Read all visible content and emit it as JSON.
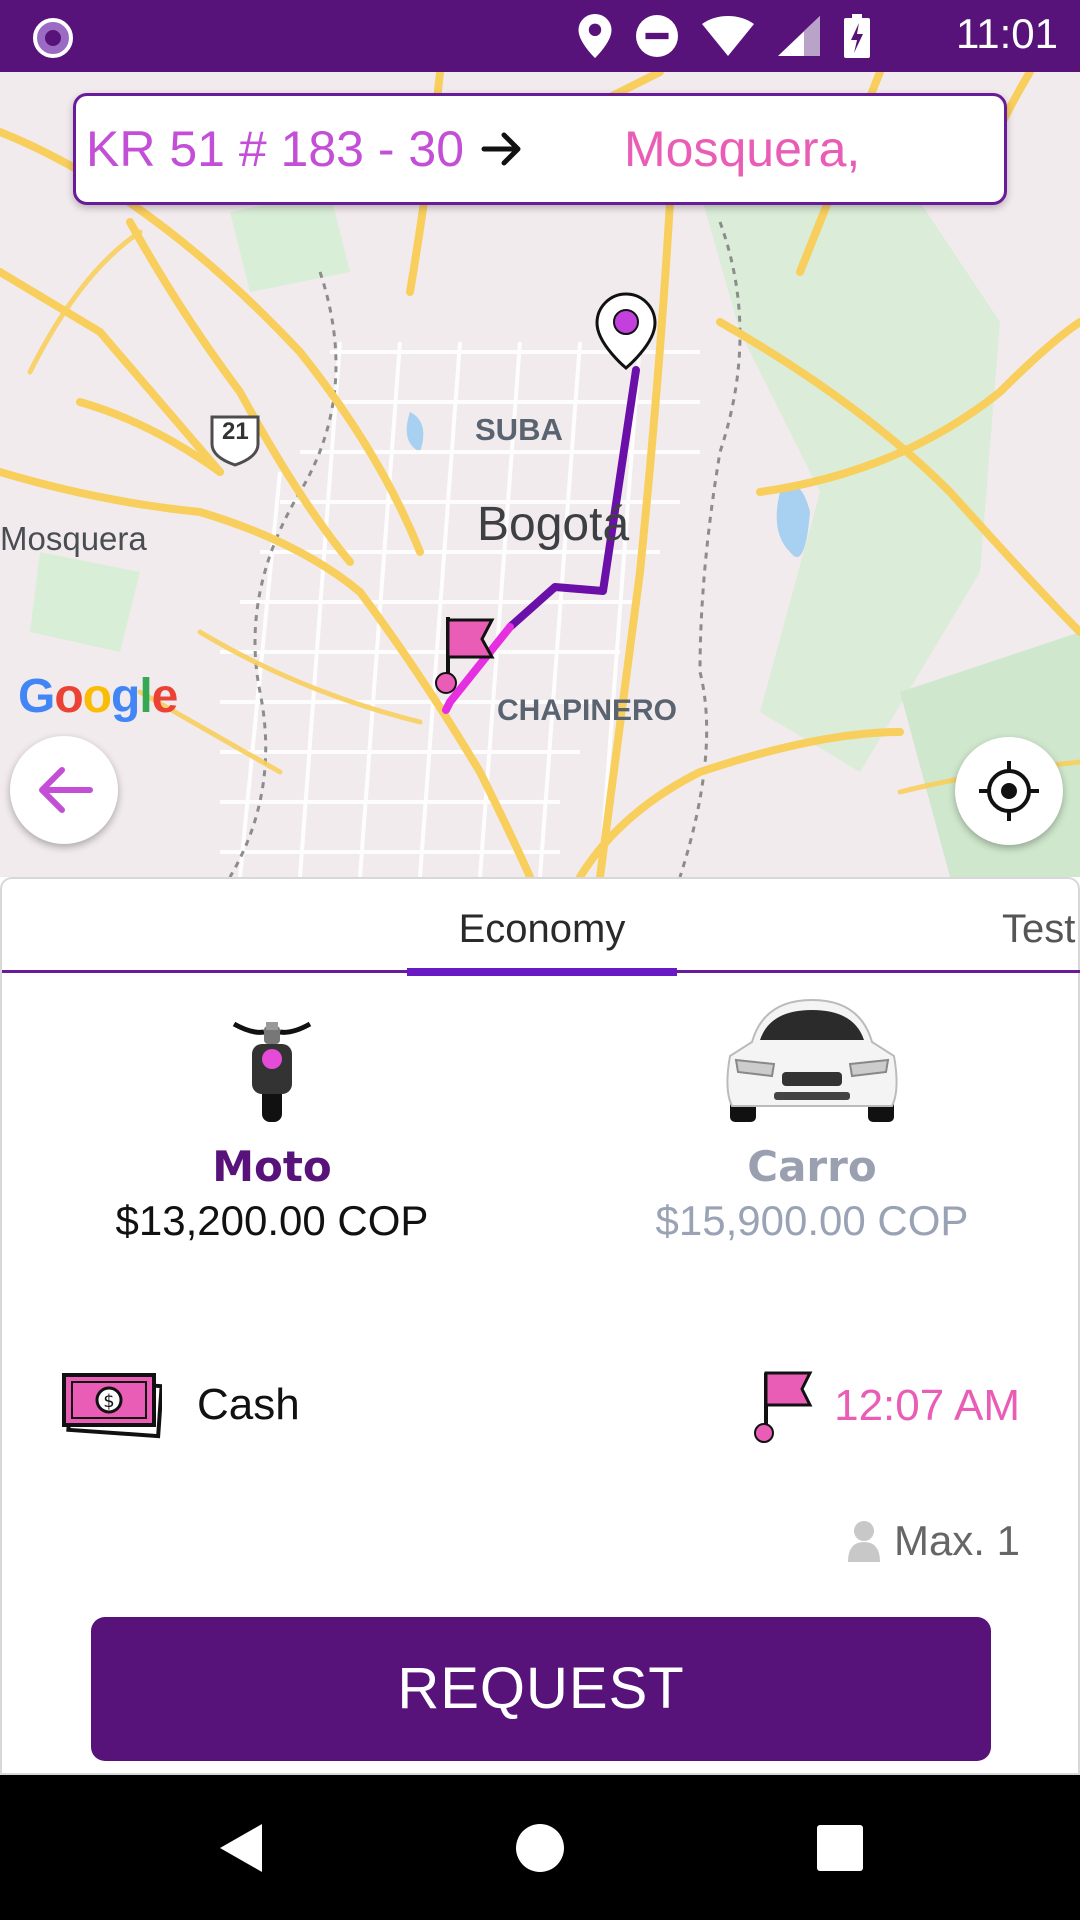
{
  "status_bar": {
    "time": "11:01",
    "icons": [
      "location-icon",
      "do-not-disturb-icon",
      "wifi-icon",
      "signal-icon",
      "battery-charging-icon"
    ]
  },
  "trip": {
    "origin": "KR 51 # 183 - 30",
    "destination": "Mosquera,"
  },
  "map": {
    "labels": {
      "suba": "SUBA",
      "bogota": "Bogotá",
      "mosquera": "Mosquera",
      "chapinero": "CHAPINERO",
      "highway": "21"
    },
    "google_logo": [
      "G",
      "o",
      "o",
      "g",
      "l",
      "e"
    ],
    "route_colors": {
      "purple": "#6a0fa8",
      "pink": "#e52fe0"
    }
  },
  "tabs": {
    "active": "Economy",
    "next": "Test"
  },
  "vehicles": [
    {
      "name": "Moto",
      "price": "$13,200.00 COP",
      "selected": true
    },
    {
      "name": "Carro",
      "price": "$15,900.00 COP",
      "selected": false
    }
  ],
  "payment": {
    "label": "Cash"
  },
  "eta": {
    "time": "12:07 AM"
  },
  "capacity": {
    "text": "Max. 1"
  },
  "request_button": {
    "label": "REQUEST"
  },
  "colors": {
    "brand": "#58137a",
    "accent": "#ea5db6",
    "tab_indicator": "#6a1ac4"
  }
}
